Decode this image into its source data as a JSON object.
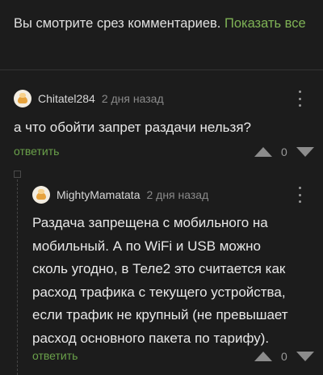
{
  "notice": {
    "text": "Вы смотрите срез комментариев. ",
    "show_all": "Показать все"
  },
  "comments": [
    {
      "username": "Chitatel284",
      "time": "2 дня назад",
      "text": "а что обойти запрет раздачи нельзя?",
      "reply_label": "ответить",
      "score": "0"
    },
    {
      "username": "MightyMamatata",
      "time": "2 дня назад",
      "text": "Раздача запрещена с мобильного на мобильный. А по WiFi и USB можно сколь угодно, в Теле2 это считается как расход трафика с текущего устройства, если трафик не крупный (не превышает расход основного пакета по тарифу).",
      "reply_label": "ответить",
      "score": "0"
    }
  ],
  "colors": {
    "background": "#1c1c1c",
    "accent_link": "#7fb356",
    "reply_green": "#6aa14a"
  },
  "icons": [
    "avatar",
    "more-vertical-icon",
    "upvote-arrow-icon",
    "downvote-arrow-icon",
    "collapse-thread-icon"
  ]
}
